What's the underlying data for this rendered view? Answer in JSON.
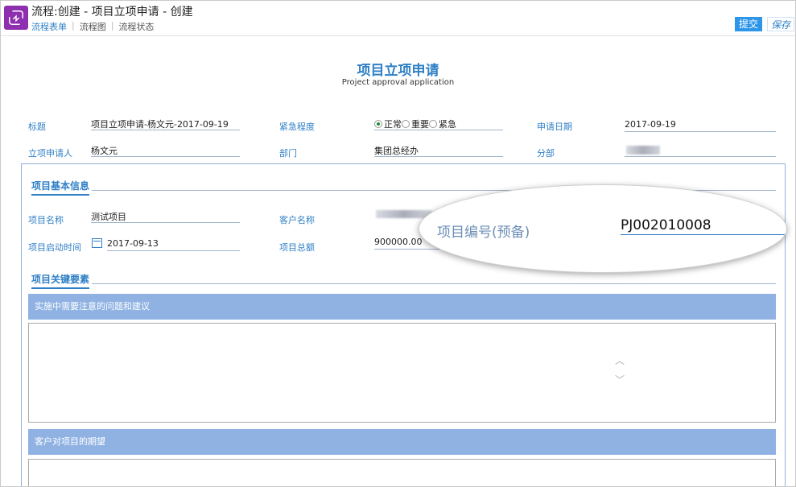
{
  "header": {
    "title": "流程:创建 - 项目立项申请 - 创建",
    "tabs": [
      "流程表单",
      "流程图",
      "流程状态"
    ],
    "submit_label": "提交",
    "save_label": "保存",
    "app_icon": "flow-icon",
    "accent_color": "#2f7fc6",
    "icon_color": "#8e2fb0"
  },
  "form": {
    "title": "项目立项申请",
    "subtitle": "Project approval application",
    "fields": {
      "title_label": "标题",
      "title_value": "项目立项申请-杨文元-2017-09-19",
      "urgency_label": "紧急程度",
      "urgency_options": [
        "正常",
        "重要",
        "紧急"
      ],
      "urgency_selected": "正常",
      "apply_date_label": "申请日期",
      "apply_date_value": "2017-09-19",
      "applicant_label": "立项申请人",
      "applicant_value": "杨文元",
      "dept_label": "部门",
      "dept_value": "集团总经办",
      "branch_label": "分部"
    }
  },
  "basic_info": {
    "heading": "项目基本信息",
    "project_name_label": "项目名称",
    "project_name_value": "测试项目",
    "customer_label": "客户名称",
    "start_time_label": "项目启动时间",
    "start_time_value": "2017-09-13",
    "total_label": "项目总额",
    "total_value": "900000.00"
  },
  "key_elements": {
    "heading": "项目关键要素",
    "bar1": "实施中需要注意的问题和建议",
    "bar2": "客户对项目的期望"
  },
  "magnifier": {
    "label": "项目编号(预备)",
    "value": "PJ002010008"
  }
}
